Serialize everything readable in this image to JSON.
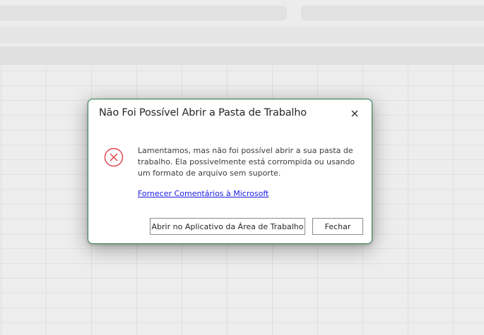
{
  "dialog": {
    "title": "Não Foi Possível Abrir a Pasta de Trabalho",
    "close_icon": "close-icon",
    "error_icon": "error-circle-x-icon",
    "message": "Lamentamos, mas não foi possível abrir a sua pasta de trabalho. Ela possivelmente está corrompida ou usando um formato de arquivo sem suporte.",
    "feedback_link": "Fornecer Comentários à Microsoft",
    "buttons": {
      "open_desktop": "Abrir no Aplicativo da Área de Trabalho",
      "close": "Fechar"
    }
  },
  "colors": {
    "border_accent": "#2e7d4f",
    "error_red": "#e0404a",
    "link_blue": "#1a1ae6"
  }
}
